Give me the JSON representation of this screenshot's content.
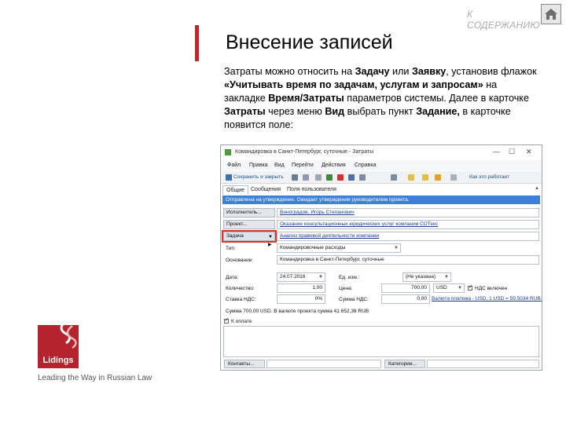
{
  "slide": {
    "title": "Внесение записей",
    "toc_link": "К СОДЕРЖАНИЮ",
    "body_parts": [
      "Затраты можно относить на ",
      "Задачу",
      " или ",
      "Заявку",
      ", установив флажок ",
      "«Учитывать время по задачам, услугам и запросам»",
      " на закладке ",
      "Время/Затраты",
      " параметров системы. Далее в карточке ",
      "Затраты",
      " через меню ",
      "Вид",
      " выбрать пункт ",
      "Задание,",
      " в карточке появится поле:"
    ],
    "logo_text": "Lidings",
    "tagline": "Leading the Way in Russian Law",
    "colors": {
      "accent_red": "#c0282e",
      "logo_red": "#b5232d",
      "notice_blue": "#3e82d6"
    }
  },
  "window": {
    "title": "Командировка в Санкт-Петербург, суточные - Затраты",
    "controls": [
      "—",
      "☐",
      "✕"
    ],
    "menu": [
      "Файл",
      "Правка",
      "Вид",
      "Перейти",
      "Действия",
      "Справка"
    ],
    "toolbar": {
      "save_close": "Сохранить и закрыть",
      "help": "Как это работает"
    },
    "tabs": [
      "Общие",
      "Сообщения",
      "Поля пользователя"
    ],
    "notice": "Отправлена на утверждение. Ожидает утверждения руководителем проекта.",
    "rows": [
      {
        "button": "Исполнитель...",
        "value": "Виноградов, Игорь Степанович"
      },
      {
        "button": "Проект...",
        "value": "Оказание консультационных юридических услуг компании СОТекс"
      },
      {
        "button": "Задача",
        "value": "Анализ правовой деятельности компании"
      }
    ],
    "type_label": "Тип:",
    "type_value": "Командировочные расходы",
    "basis_label": "Основание:",
    "basis_value": "Командировка в Санкт-Петербург, суточные",
    "date_label": "Дата:",
    "date_value": "24.07.2016",
    "unit_label": "Ед. изм.:",
    "unit_value": "(Не указана)",
    "qty_label": "Количество:",
    "qty_value": "1,00",
    "price_label": "Цена:",
    "price_value": "700,00",
    "currency_value": "USD",
    "vat_included": "НДС включен",
    "vat_rate_label": "Ставка НДС:",
    "vat_rate_value": "0%",
    "vat_sum_label": "Сумма НДС:",
    "vat_sum_value": "0,00",
    "rate_link": "Валюта платежа - USD, 1 USD = 59,5034 RUB.",
    "sum_text": "Сумма 700,00 USD. В валюте проекта сумма 41 652,38 RUB",
    "to_pay": "К оплате",
    "contacts_button": "Контакты...",
    "categories_button": "Категории..."
  }
}
